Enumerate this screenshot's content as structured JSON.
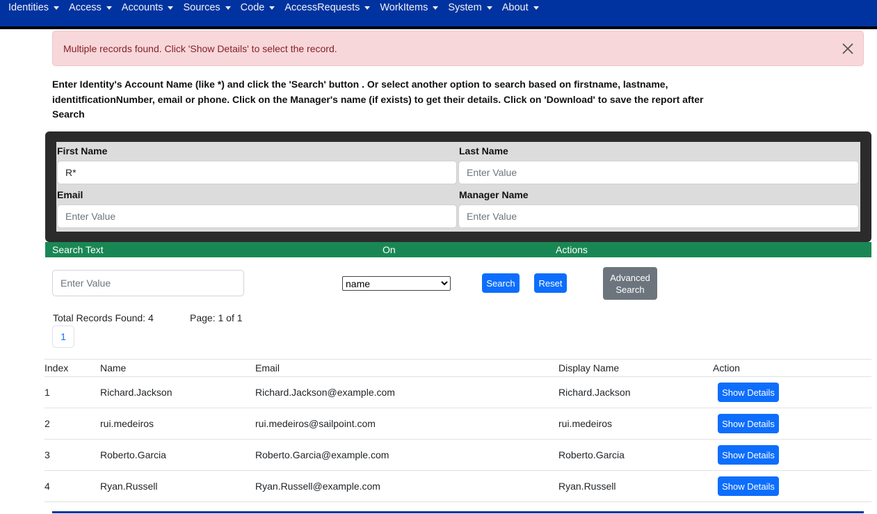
{
  "nav": {
    "items": [
      {
        "label": "Identities"
      },
      {
        "label": "Access"
      },
      {
        "label": "Accounts"
      },
      {
        "label": "Sources"
      },
      {
        "label": "Code"
      },
      {
        "label": "AccessRequests"
      },
      {
        "label": "WorkItems"
      },
      {
        "label": "System"
      },
      {
        "label": "About"
      }
    ]
  },
  "alert": {
    "message": "Multiple records found. Click 'Show Details' to select the record.",
    "close_icon": "close-icon"
  },
  "instructions": "Enter Identity's Account Name (like *) and click the 'Search' button . Or select another option to search based on firstname, lastname, identitficationNumber, email or phone. Click on the Manager's name (if exists) to get their details. Click on 'Download' to save the report after Search",
  "form": {
    "first_name": {
      "label": "First Name",
      "value": "R*",
      "placeholder": "Enter Value"
    },
    "last_name": {
      "label": "Last Name",
      "value": "",
      "placeholder": "Enter Value"
    },
    "email": {
      "label": "Email",
      "value": "",
      "placeholder": "Enter Value"
    },
    "manager_name": {
      "label": "Manager Name",
      "value": "",
      "placeholder": "Enter Value"
    }
  },
  "search_bar": {
    "header_search_text": "Search Text",
    "header_on": "On",
    "header_actions": "Actions",
    "search_placeholder": "Enter Value",
    "on_selected": "name",
    "search_label": "Search",
    "reset_label": "Reset",
    "advanced_label": "Advanced Search"
  },
  "records": {
    "total_text": "Total Records Found: 4",
    "page_text": "Page: 1 of 1",
    "page_link": "1"
  },
  "table": {
    "headers": {
      "index": "Index",
      "name": "Name",
      "email": "Email",
      "display_name": "Display Name",
      "action": "Action"
    },
    "rows": [
      {
        "index": "1",
        "name": "Richard.Jackson",
        "email": "Richard.Jackson@example.com",
        "display_name": "Richard.Jackson",
        "action": "Show Details"
      },
      {
        "index": "2",
        "name": "rui.medeiros",
        "email": "rui.medeiros@sailpoint.com",
        "display_name": "rui.medeiros",
        "action": "Show Details"
      },
      {
        "index": "3",
        "name": "Roberto.Garcia",
        "email": "Roberto.Garcia@example.com",
        "display_name": "Roberto.Garcia",
        "action": "Show Details"
      },
      {
        "index": "4",
        "name": "Ryan.Russell",
        "email": "Ryan.Russell@example.com",
        "display_name": "Ryan.Russell",
        "action": "Show Details"
      }
    ]
  },
  "colors": {
    "navbar": "#0033a0",
    "alert_bg": "#f8d7da",
    "alert_text": "#842029",
    "green_header": "#198754",
    "primary": "#0d6efd",
    "secondary": "#6c757d"
  }
}
